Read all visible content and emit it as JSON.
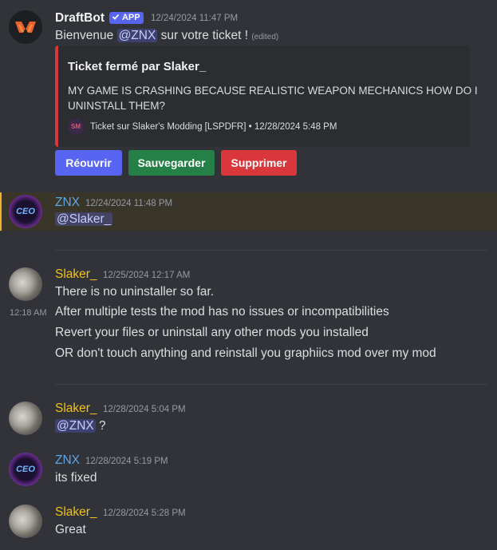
{
  "colors": {
    "background": "#313338",
    "highlight": "#3a3529",
    "embed_bg": "#2b2d31",
    "embed_border": "#da373c",
    "blurple": "#5865f2",
    "green": "#248046",
    "red": "#da373c",
    "znx_name": "#5ca6e8",
    "slaker_name": "#f1c40f"
  },
  "messages": {
    "draftbot": {
      "username": "DraftBot",
      "badge": "APP",
      "timestamp": "12/24/2024 11:47 PM",
      "text_before": "Bienvenue ",
      "mention": "@ZNX",
      "text_after": " sur votre ticket !",
      "edited": "(edited)",
      "embed": {
        "title": "Ticket fermé par Slaker_",
        "description_line1": "MY GAME IS CRASHING BECAUSE REALISTIC WEAPON MECHANICS HOW DO I",
        "description_line2": "UNINSTALL THEM?",
        "footer_icon_text": "SM",
        "footer_text": "Ticket sur Slaker's Modding [LSPDFR] • 12/28/2024 5:48 PM"
      },
      "buttons": {
        "reopen": "Réouvrir",
        "save": "Sauvegarder",
        "delete": "Supprimer"
      }
    },
    "znx1": {
      "username": "ZNX",
      "timestamp": "12/24/2024 11:48 PM",
      "mention": "@Slaker_",
      "avatar_text": "CEO"
    },
    "slaker1": {
      "username": "Slaker_",
      "timestamp": "12/25/2024 12:17 AM",
      "line1": "There is no uninstaller so far.",
      "line2_time": "12:18 AM",
      "line2": "After multiple tests the mod has no issues or incompatibilities",
      "line3": "Revert your files or uninstall any other mods you installed",
      "line4": "OR don't touch anything and reinstall you graphiics mod over my mod"
    },
    "slaker2": {
      "username": "Slaker_",
      "timestamp": "12/28/2024 5:04 PM",
      "mention": "@ZNX",
      "text_after": " ?"
    },
    "znx2": {
      "username": "ZNX",
      "timestamp": "12/28/2024 5:19 PM",
      "text": "its fixed",
      "avatar_text": "CEO"
    },
    "slaker3": {
      "username": "Slaker_",
      "timestamp": "12/28/2024 5:28 PM",
      "text": "Great"
    }
  }
}
